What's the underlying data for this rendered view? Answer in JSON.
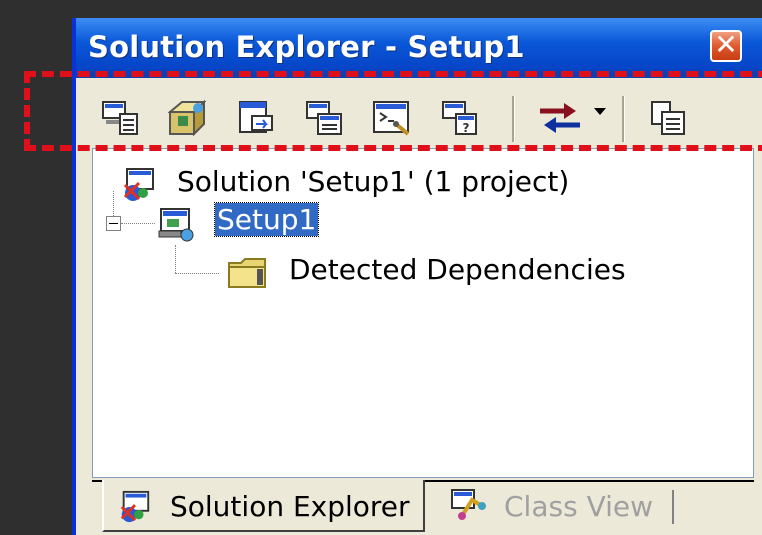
{
  "window": {
    "title": "Solution Explorer - Setup1",
    "close_glyph": "✕"
  },
  "toolbar": {
    "buttons": [
      {
        "name": "properties-icon"
      },
      {
        "name": "file-system-editor-icon"
      },
      {
        "name": "registry-editor-icon"
      },
      {
        "name": "file-types-editor-icon"
      },
      {
        "name": "user-interface-editor-icon"
      },
      {
        "name": "custom-actions-editor-icon"
      },
      {
        "name": "launch-conditions-editor-icon"
      },
      {
        "name": "view-more-icon"
      },
      {
        "name": "copy-icon"
      }
    ]
  },
  "tree": {
    "solution_label": "Solution 'Setup1' (1 project)",
    "project_label": "Setup1",
    "dependencies_label": "Detected Dependencies"
  },
  "tabs": {
    "solution_explorer": "Solution Explorer",
    "class_view": "Class View"
  },
  "colors": {
    "highlight": "#e0101a",
    "titlebar": "#0a58d8",
    "selection": "#316ac5"
  }
}
